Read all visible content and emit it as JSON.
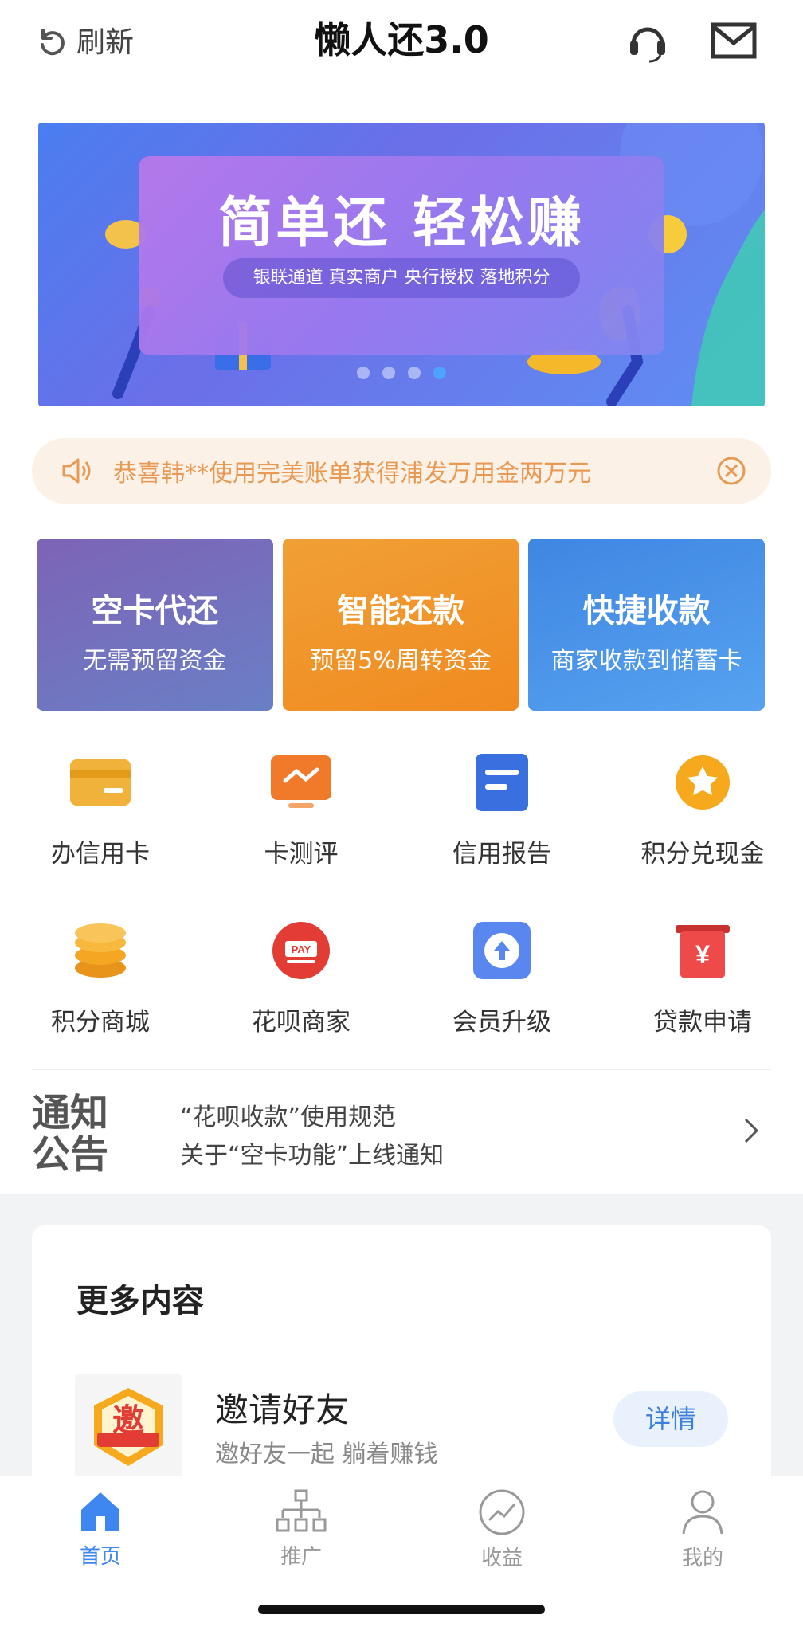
{
  "header": {
    "refresh_label": "刷新",
    "title": "懒人还3.0",
    "support_icon": "headset-icon",
    "mail_icon": "mail-icon"
  },
  "banner": {
    "headline": "简单还 轻松赚",
    "subline": "银联通道 真实商户 央行授权 落地积分",
    "slide_count": 4,
    "active_slide": 4
  },
  "marquee": {
    "text": "恭喜韩**使用完美账单获得浦发万用金两万元",
    "icon": "speaker-icon"
  },
  "feature_cards": [
    {
      "title": "空卡代还",
      "subtitle": "无需预留资金"
    },
    {
      "title": "智能还款",
      "subtitle": "预留5%周转资金"
    },
    {
      "title": "快捷收款",
      "subtitle": "商家收款到储蓄卡"
    }
  ],
  "grid": [
    {
      "label": "办信用卡",
      "icon": "credit-card-icon",
      "color": "#f0b23a"
    },
    {
      "label": "卡测评",
      "icon": "card-evaluation-icon",
      "color": "#f07a2a"
    },
    {
      "label": "信用报告",
      "icon": "credit-report-icon",
      "color": "#3a6fe0"
    },
    {
      "label": "积分兑现金",
      "icon": "points-cash-icon",
      "color": "#f6a91c"
    },
    {
      "label": "积分商城",
      "icon": "points-mall-icon",
      "color": "#f5a623"
    },
    {
      "label": "花呗商家",
      "icon": "huabei-pay-icon",
      "color": "#e23c35"
    },
    {
      "label": "会员升级",
      "icon": "upgrade-icon",
      "color": "#5a86f0"
    },
    {
      "label": "贷款申请",
      "icon": "loan-icon",
      "color": "#ee4a4a"
    }
  ],
  "announcement": {
    "logo_line1": "通知",
    "logo_line2": "公告",
    "items": [
      "“花呗收款”使用规范",
      "关于“空卡功能”上线通知"
    ]
  },
  "more_content": {
    "heading": "更多内容",
    "invite": {
      "icon_text": "邀",
      "title": "邀请好友",
      "subtitle": "邀好友一起 躺着赚钱",
      "button": "详情"
    }
  },
  "tabbar": [
    {
      "label": "首页",
      "icon": "home-icon",
      "active": true
    },
    {
      "label": "推广",
      "icon": "org-chart-icon",
      "active": false
    },
    {
      "label": "收益",
      "icon": "trend-icon",
      "active": false
    },
    {
      "label": "我的",
      "icon": "user-icon",
      "active": false
    }
  ]
}
